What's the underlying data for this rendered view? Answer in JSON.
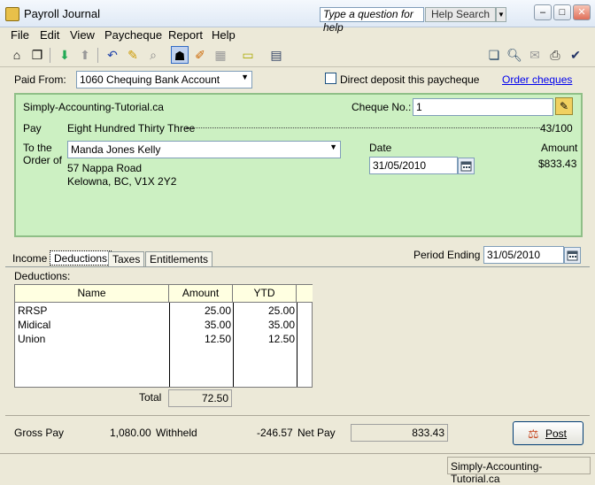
{
  "window": {
    "title": "Payroll Journal",
    "help_placeholder": "Type a question for help",
    "help_search": "Help Search"
  },
  "menu": [
    "File",
    "Edit",
    "View",
    "Paycheque",
    "Report",
    "Help"
  ],
  "paid_from": {
    "label": "Paid From:",
    "value": "1060 Chequing Bank Account"
  },
  "direct_deposit": {
    "label": "Direct deposit this paycheque",
    "checked": false
  },
  "order_cheques": "Order cheques",
  "cheque": {
    "company": "Simply-Accounting-Tutorial.ca",
    "cheque_no_label": "Cheque No.:",
    "cheque_no": "1",
    "pay_label": "Pay",
    "pay_words": "Eight Hundred Thirty Three",
    "cents": "43/100",
    "to_order_line1": "To the",
    "to_order_line2": "Order of",
    "payee": "Manda Jones Kelly",
    "address_line1": "57 Nappa Road",
    "address_line2": "Kelowna, BC, V1X 2Y2",
    "date_label": "Date",
    "date": "31/05/2010",
    "amount_label": "Amount",
    "amount": "$833.43"
  },
  "tabs": [
    "Income",
    "Deductions",
    "Taxes",
    "Entitlements"
  ],
  "period_ending": {
    "label": "Period Ending",
    "value": "31/05/2010"
  },
  "deductions": {
    "label": "Deductions:",
    "headers": [
      "Name",
      "Amount",
      "YTD"
    ],
    "rows": [
      {
        "name": "RRSP",
        "amount": "25.00",
        "ytd": "25.00"
      },
      {
        "name": "Midical",
        "amount": "35.00",
        "ytd": "35.00"
      },
      {
        "name": "Union",
        "amount": "12.50",
        "ytd": "12.50"
      }
    ],
    "total_label": "Total",
    "total": "72.50"
  },
  "summary": {
    "gross_label": "Gross Pay",
    "gross": "1,080.00",
    "withheld_label": "Withheld",
    "withheld": "-246.57",
    "net_label": "Net Pay",
    "net": "833.43"
  },
  "post_button": "Post",
  "status": "Simply-Accounting-Tutorial.ca"
}
